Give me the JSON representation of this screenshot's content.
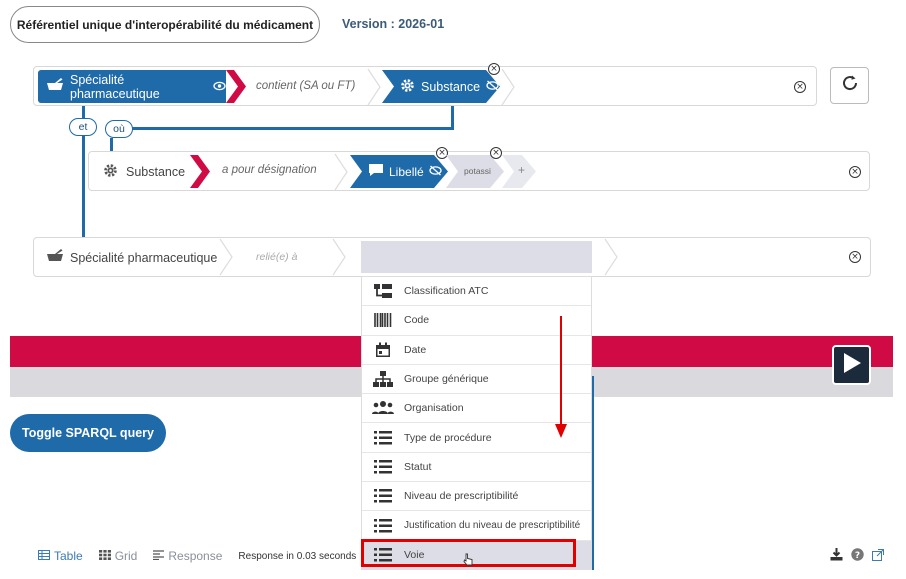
{
  "header": {
    "title": "Référentiel unique d'interopérabilité du médicament",
    "version": "Version : 2026-01"
  },
  "row1": {
    "subject": "Spécialité pharmaceutique",
    "predicate": "contient (SA ou FT)",
    "object": "Substance"
  },
  "connectors": {
    "et": "et",
    "ou": "où"
  },
  "row2": {
    "subject": "Substance",
    "predicate": "a pour désignation",
    "object": "Libellé",
    "value": "potassi",
    "add": "+"
  },
  "row3": {
    "subject": "Spécialité pharmaceutique",
    "predicate": "relié(e) à"
  },
  "dropdown": {
    "items": [
      {
        "label": "Classification ATC",
        "icon": "tree-icon"
      },
      {
        "label": "Code",
        "icon": "barcode-icon"
      },
      {
        "label": "Date",
        "icon": "calendar-icon"
      },
      {
        "label": "Groupe générique",
        "icon": "sitemap-icon"
      },
      {
        "label": "Organisation",
        "icon": "users-icon"
      },
      {
        "label": "Type de procédure",
        "icon": "list-icon"
      },
      {
        "label": "Statut",
        "icon": "list-icon"
      },
      {
        "label": "Niveau de prescriptibilité",
        "icon": "list-icon"
      },
      {
        "label": "Justification du niveau de prescriptibilité",
        "icon": "list-icon"
      },
      {
        "label": "Voie",
        "icon": "list-icon"
      }
    ]
  },
  "toggle_button": "Toggle SPARQL query",
  "results": {
    "tabs": [
      "Table",
      "Grid",
      "Response"
    ],
    "response_time": "Response in 0.03 seconds"
  },
  "colors": {
    "primary_blue": "#1f6aa9",
    "accent_red": "#cf0a45",
    "annotation_red": "#e00000"
  }
}
